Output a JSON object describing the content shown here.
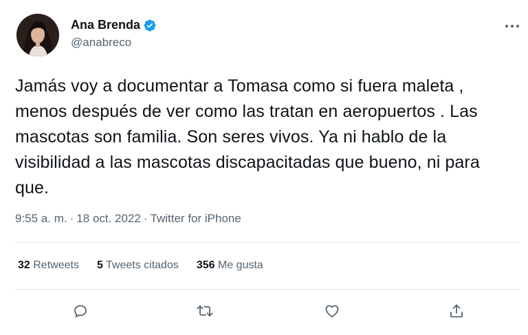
{
  "author": {
    "name": "Ana Brenda",
    "handle": "@anabreco",
    "verified": true,
    "accent_color": "#1d9bf0"
  },
  "tweet": {
    "text": "Jamás voy a documentar a Tomasa como si fuera maleta , menos después de ver como las tratan en aeropuertos . Las mascotas son familia. Son seres vivos. Ya ni hablo de la visibilidad a las mascotas discapacitadas que bueno, ni para que.",
    "time": "9:55 a. m.",
    "separator": "·",
    "date": "18 oct. 2022",
    "source": "Twitter for iPhone"
  },
  "stats": {
    "retweets_count": "32",
    "retweets_label": "Retweets",
    "quotes_count": "5",
    "quotes_label": "Tweets citados",
    "likes_count": "356",
    "likes_label": "Me gusta"
  },
  "icons": {
    "more": "more-icon",
    "reply": "reply-icon",
    "retweet": "retweet-icon",
    "like": "like-icon",
    "share": "share-icon",
    "verified": "verified-badge-icon"
  },
  "colors": {
    "text_primary": "#0f1419",
    "text_secondary": "#536471",
    "divider": "#e3e8ec"
  }
}
